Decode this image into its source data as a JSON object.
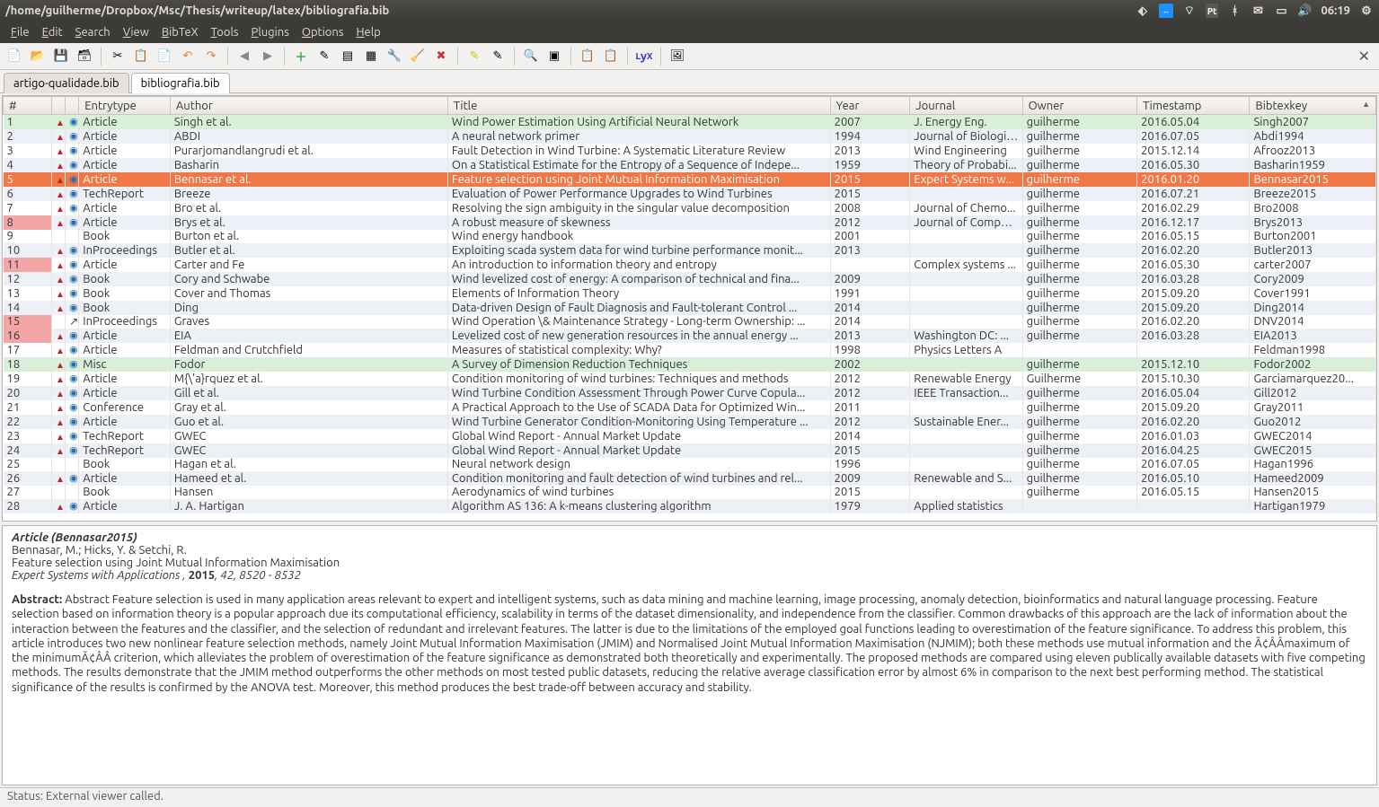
{
  "title_path": "/home/guilherme/Dropbox/Msc/Thesis/writeup/latex/bibliografia.bib",
  "clock": "06:19",
  "kbd": "Pt",
  "menus": [
    "File",
    "Edit",
    "Search",
    "View",
    "BibTeX",
    "Tools",
    "Plugins",
    "Options",
    "Help"
  ],
  "tabs": [
    {
      "label": "artigo-qualidade.bib",
      "active": false
    },
    {
      "label": "bibliografia.bib",
      "active": true
    }
  ],
  "columns": [
    "#",
    "",
    "",
    "Entrytype",
    "Author",
    "Title",
    "Year",
    "Journal",
    "Owner",
    "Timestamp",
    "Bibtexkey"
  ],
  "rows": [
    {
      "n": 1,
      "pdf": true,
      "web": true,
      "type": "Article",
      "author": "Singh et al.",
      "title": "Wind Power Estimation Using Artificial Neural Network",
      "year": "2007",
      "journal": "J. Energy Eng.",
      "owner": "guilherme",
      "ts": "2016.05.04",
      "key": "Singh2007",
      "cls": "green"
    },
    {
      "n": 2,
      "pdf": true,
      "web": true,
      "type": "Article",
      "author": "ABDI",
      "title": "A neural network primer",
      "year": "1994",
      "journal": "Journal of Biologic...",
      "owner": "guilherme",
      "ts": "2016.07.05",
      "key": "Abdi1994",
      "cls": "even"
    },
    {
      "n": 3,
      "pdf": true,
      "web": true,
      "type": "Article",
      "author": "Purarjomandlangrudi et al.",
      "title": "Fault Detection in Wind Turbine: A Systematic Literature Review",
      "year": "2013",
      "journal": "Wind Engineering",
      "owner": "guilherme",
      "ts": "2015.12.14",
      "key": "Afrooz2013",
      "cls": "odd"
    },
    {
      "n": 4,
      "pdf": true,
      "web": true,
      "type": "Article",
      "author": "Basharin",
      "title": "On a Statistical Estimate for the Entropy of a Sequence of Indepe...",
      "year": "1959",
      "journal": "Theory of Probabi...",
      "owner": "guilherme",
      "ts": "2016.05.30",
      "key": "Basharin1959",
      "cls": "even"
    },
    {
      "n": 5,
      "pdf": true,
      "web": true,
      "type": "Article",
      "author": "Bennasar et al.",
      "title": "Feature selection using Joint Mutual Information Maximisation",
      "year": "2015",
      "journal": "Expert Systems w...",
      "owner": "guilherme",
      "ts": "2016.01.20",
      "key": "Bennasar2015",
      "cls": "sel"
    },
    {
      "n": 6,
      "pdf": true,
      "web": true,
      "type": "TechReport",
      "author": "Breeze",
      "title": "Evaluation of Power Performance Upgrades to Wind Turbines",
      "year": "2015",
      "journal": "",
      "owner": "guilherme",
      "ts": "2016.07.21",
      "key": "Breeze2015",
      "cls": "even"
    },
    {
      "n": 7,
      "pdf": true,
      "web": true,
      "type": "Article",
      "author": "Bro et al.",
      "title": "Resolving the sign ambiguity in the singular value decomposition",
      "year": "2008",
      "journal": "Journal of Chemo...",
      "owner": "guilherme",
      "ts": "2016.02.29",
      "key": "Bro2008",
      "cls": "odd"
    },
    {
      "n": 8,
      "pdf": true,
      "web": true,
      "type": "Article",
      "author": "Brys et al.",
      "title": "A robust measure of skewness",
      "year": "2012",
      "journal": "Journal of Comput...",
      "owner": "guilherme",
      "ts": "2016.12.17",
      "key": "Brys2013",
      "cls": "even",
      "mark": true
    },
    {
      "n": 9,
      "pdf": false,
      "web": false,
      "type": "Book",
      "author": "Burton et al.",
      "title": "Wind energy handbook",
      "year": "2001",
      "journal": "",
      "owner": "guilherme",
      "ts": "2016.05.15",
      "key": "Burton2001",
      "cls": "odd"
    },
    {
      "n": 10,
      "pdf": true,
      "web": true,
      "type": "InProceedings",
      "author": "Butler et al.",
      "title": "Exploiting scada system data for wind turbine performance monit...",
      "year": "2013",
      "journal": "",
      "owner": "guilherme",
      "ts": "2016.02.20",
      "key": "Butler2013",
      "cls": "even"
    },
    {
      "n": 11,
      "pdf": true,
      "web": true,
      "type": "Article",
      "author": "Carter and Fe",
      "title": "An introduction to information theory and entropy",
      "year": "",
      "journal": "Complex systems ...",
      "owner": "guilherme",
      "ts": "2016.05.30",
      "key": "carter2007",
      "cls": "odd",
      "mark": true
    },
    {
      "n": 12,
      "pdf": true,
      "web": true,
      "type": "Book",
      "author": "Cory and Schwabe",
      "title": "Wind levelized cost of energy: A comparison of technical and fina...",
      "year": "2009",
      "journal": "",
      "owner": "guilherme",
      "ts": "2016.03.28",
      "key": "Cory2009",
      "cls": "even"
    },
    {
      "n": 13,
      "pdf": true,
      "web": true,
      "type": "Book",
      "author": "Cover and Thomas",
      "title": "Elements of Information Theory",
      "year": "1991",
      "journal": "",
      "owner": "guilherme",
      "ts": "2015.09.20",
      "key": "Cover1991",
      "cls": "odd"
    },
    {
      "n": 14,
      "pdf": true,
      "web": true,
      "type": "Book",
      "author": "Ding",
      "title": "Data-driven Design of Fault Diagnosis and Fault-tolerant Control ...",
      "year": "2014",
      "journal": "",
      "owner": "guilherme",
      "ts": "2015.09.20",
      "key": "Ding2014",
      "cls": "even"
    },
    {
      "n": 15,
      "pdf": false,
      "ext": true,
      "web": false,
      "type": "InProceedings",
      "author": "Graves",
      "title": "Wind Operation \\& Maintenance Strategy - Long-term Ownership: ...",
      "year": "2014",
      "journal": "",
      "owner": "guilherme",
      "ts": "2016.02.20",
      "key": "DNV2014",
      "cls": "odd",
      "mark": true
    },
    {
      "n": 16,
      "pdf": true,
      "web": true,
      "type": "Article",
      "author": "EIA",
      "title": "Levelized cost of new generation resources in the annual energy ...",
      "year": "2013",
      "journal": "Washington DC: ...",
      "owner": "guilherme",
      "ts": "2016.03.28",
      "key": "EIA2013",
      "cls": "even",
      "mark": true
    },
    {
      "n": 17,
      "pdf": true,
      "web": true,
      "type": "Article",
      "author": "Feldman and Crutchfield",
      "title": "Measures of statistical complexity: Why?",
      "year": "1998",
      "journal": "Physics Letters A",
      "owner": "",
      "ts": "",
      "key": "Feldman1998",
      "cls": "odd"
    },
    {
      "n": 18,
      "pdf": true,
      "web": true,
      "type": "Misc",
      "author": "Fodor",
      "title": "A Survey of Dimension Reduction Techniques",
      "year": "2002",
      "journal": "",
      "owner": "guilherme",
      "ts": "2015.12.10",
      "key": "Fodor2002",
      "cls": "green"
    },
    {
      "n": 19,
      "pdf": true,
      "web": true,
      "type": "Article",
      "author": "M{\\'a}rquez et al.",
      "title": "Condition monitoring of wind turbines: Techniques and methods",
      "year": "2012",
      "journal": "Renewable Energy",
      "owner": "Guilherme",
      "ts": "2015.10.30",
      "key": "Garciamarquez20...",
      "cls": "odd"
    },
    {
      "n": 20,
      "pdf": true,
      "web": true,
      "type": "Article",
      "author": "Gill et al.",
      "title": "Wind Turbine Condition Assessment Through Power Curve Copula...",
      "year": "2012",
      "journal": "IEEE Transaction...",
      "owner": "guilherme",
      "ts": "2016.05.04",
      "key": "Gill2012",
      "cls": "even"
    },
    {
      "n": 21,
      "pdf": true,
      "web": true,
      "type": "Conference",
      "author": "Gray et al.",
      "title": "A Practical Approach to the Use of SCADA Data for Optimized Win...",
      "year": "2011",
      "journal": "",
      "owner": "guilherme",
      "ts": "2015.09.20",
      "key": "Gray2011",
      "cls": "odd"
    },
    {
      "n": 22,
      "pdf": true,
      "web": true,
      "type": "Article",
      "author": "Guo et al.",
      "title": "Wind Turbine Generator Condition-Monitoring Using Temperature ...",
      "year": "2012",
      "journal": "Sustainable Ener...",
      "owner": "guilherme",
      "ts": "2016.02.20",
      "key": "Guo2012",
      "cls": "even"
    },
    {
      "n": 23,
      "pdf": true,
      "web": true,
      "type": "TechReport",
      "author": "GWEC",
      "title": "Global Wind Report - Annual Market Update",
      "year": "2014",
      "journal": "",
      "owner": "guilherme",
      "ts": "2016.01.03",
      "key": "GWEC2014",
      "cls": "odd"
    },
    {
      "n": 24,
      "pdf": true,
      "web": true,
      "type": "TechReport",
      "author": "GWEC",
      "title": "Global Wind Report - Annual Market Update",
      "year": "2015",
      "journal": "",
      "owner": "guilherme",
      "ts": "2016.04.25",
      "key": "GWEC2015",
      "cls": "even"
    },
    {
      "n": 25,
      "pdf": false,
      "web": false,
      "type": "Book",
      "author": "Hagan et al.",
      "title": "Neural network design",
      "year": "1996",
      "journal": "",
      "owner": "guilherme",
      "ts": "2016.07.05",
      "key": "Hagan1996",
      "cls": "odd"
    },
    {
      "n": 26,
      "pdf": true,
      "web": true,
      "type": "Article",
      "author": "Hameed et al.",
      "title": "Condition monitoring and fault detection of wind turbines and rel...",
      "year": "2009",
      "journal": "Renewable and S...",
      "owner": "guilherme",
      "ts": "2016.05.10",
      "key": "Hameed2009",
      "cls": "even"
    },
    {
      "n": 27,
      "pdf": false,
      "web": false,
      "type": "Book",
      "author": "Hansen",
      "title": "Aerodynamics of wind turbines",
      "year": "2015",
      "journal": "",
      "owner": "guilherme",
      "ts": "2016.05.15",
      "key": "Hansen2015",
      "cls": "odd"
    },
    {
      "n": 28,
      "pdf": true,
      "web": true,
      "type": "Article",
      "author": "J. A. Hartigan",
      "title": "Algorithm AS 136: A k-means clustering algorithm",
      "year": "1979",
      "journal": "Applied statistics",
      "owner": "",
      "ts": "",
      "key": "Hartigan1979",
      "cls": "even"
    }
  ],
  "preview": {
    "head_type": "Article",
    "head_key": "Bennasar2015",
    "authors": "Bennasar, M.; Hicks, Y. & Setchi, R.",
    "title": "Feature selection using Joint Mutual Information Maximisation",
    "journal": "Expert Systems with Applications",
    "year": "2015",
    "vol_pages": "42, 8520 - 8532",
    "abstract_label": "Abstract:",
    "abstract": "Abstract Feature selection is used in many application areas relevant to expert and intelligent systems, such as data mining and machine learning, image processing, anomaly detection, bioinformatics and natural language processing. Feature selection based on information theory is a popular approach due its computational efficiency, scalability in terms of the dataset dimensionality, and independence from the classifier. Common drawbacks of this approach are the lack of information about the interaction between the features and the classifier, and the selection of redundant and irrelevant features. The latter is due to the limitations of the employed goal functions leading to overestimation of the feature significance. To address this problem, this article introduces two new nonlinear feature selection methods, namely Joint Mutual Information Maximisation (JMIM) and Normalised Joint Mutual Information Maximisation (NJMIM); both these methods use mutual information and the Ã¢ÂÂmaximum of the minimumÃ¢ÂÂ criterion, which alleviates the problem of overestimation of the feature significance as demonstrated both theoretically and experimentally. The proposed methods are compared using eleven publically available datasets with five competing methods. The results demonstrate that the JMIM method outperforms the other methods on most tested public datasets, reducing the relative average classification error by almost 6% in comparison to the next best performing method. The statistical significance of the results is confirmed by the ANOVA test. Moreover, this method produces the best trade-off between accuracy and stability."
  },
  "status": "Status: External viewer called."
}
